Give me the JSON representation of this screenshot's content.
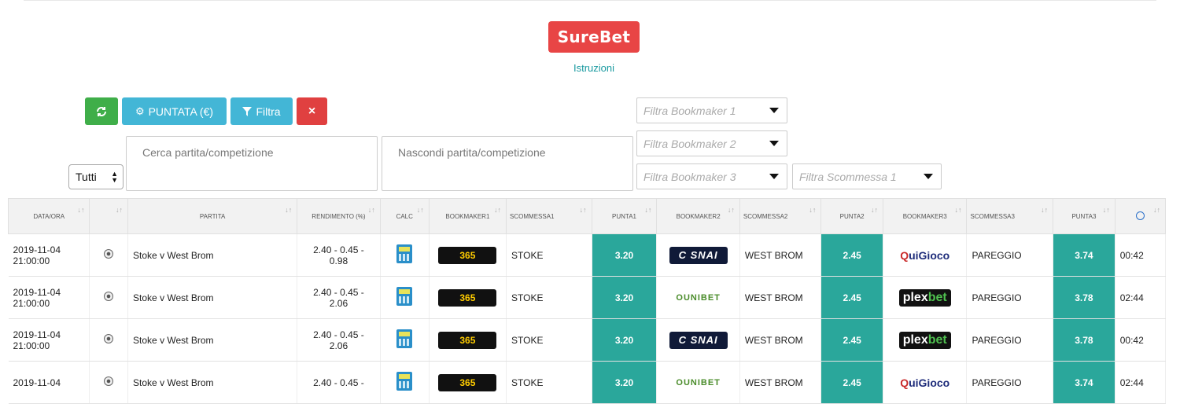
{
  "header": {
    "brand": "SureBet",
    "instructions": "Istruzioni"
  },
  "toolbar": {
    "refresh_icon": "refresh-icon",
    "stake_label": "PUNTATA (€)",
    "filter_label": "Filtra",
    "clear_label": "×"
  },
  "filters": {
    "bookmaker1": "Filtra Bookmaker 1",
    "bookmaker2": "Filtra Bookmaker 2",
    "bookmaker3": "Filtra Bookmaker 3",
    "bet1": "Filtra Scommessa 1",
    "search_placeholder": "Cerca partita/competizione",
    "hide_placeholder": "Nascondi partita/competizione",
    "scope_selected": "Tutti"
  },
  "table": {
    "headers": [
      "DATA/ORA",
      "",
      "PARTITA",
      "RENDIMENTO (%)",
      "CALC",
      "BOOKMAKER1",
      "SCOMMESSA1",
      "PUNTA1",
      "BOOKMAKER2",
      "SCOMMESSA2",
      "PUNTA2",
      "BOOKMAKER3",
      "SCOMMESSA3",
      "PUNTA3",
      ""
    ],
    "rows": [
      {
        "date": "2019-11-04",
        "time": "21:00:00",
        "match": "Stoke v West Brom",
        "yield1": "2.40 - 0.45 -",
        "yield2": "0.98",
        "bm1": "planetwin365",
        "bet1": "STOKE",
        "odd1": "3.20",
        "bm2": "snai",
        "bet2": "WEST BROM",
        "odd2": "2.45",
        "bm3": "quigioco",
        "bet3": "PAREGGIO",
        "odd3": "3.74",
        "timer": "00:42"
      },
      {
        "date": "2019-11-04",
        "time": "21:00:00",
        "match": "Stoke v West Brom",
        "yield1": "2.40 - 0.45 -",
        "yield2": "2.06",
        "bm1": "planetwin365",
        "bet1": "STOKE",
        "odd1": "3.20",
        "bm2": "unibet",
        "bet2": "WEST BROM",
        "odd2": "2.45",
        "bm3": "plexbet",
        "bet3": "PAREGGIO",
        "odd3": "3.78",
        "timer": "02:44"
      },
      {
        "date": "2019-11-04",
        "time": "21:00:00",
        "match": "Stoke v West Brom",
        "yield1": "2.40 - 0.45 -",
        "yield2": "2.06",
        "bm1": "planetwin365",
        "bet1": "STOKE",
        "odd1": "3.20",
        "bm2": "snai",
        "bet2": "WEST BROM",
        "odd2": "2.45",
        "bm3": "plexbet",
        "bet3": "PAREGGIO",
        "odd3": "3.78",
        "timer": "00:42"
      },
      {
        "date": "2019-11-04",
        "time": "",
        "match": "Stoke v West Brom",
        "yield1": "2.40 - 0.45 -",
        "yield2": "",
        "bm1": "planetwin365",
        "bet1": "STOKE",
        "odd1": "3.20",
        "bm2": "unibet",
        "bet2": "WEST BROM",
        "odd2": "2.45",
        "bm3": "quigioco",
        "bet3": "PAREGGIO",
        "odd3": "3.74",
        "timer": "02:44"
      }
    ]
  },
  "logos": {
    "planetwin365": "365",
    "snai": "C SNAI",
    "unibet": "OUNIBET",
    "plexbet_a": "plex",
    "plexbet_b": "bet",
    "quigioco_a": "Q",
    "quigioco_b": "uiGioco"
  },
  "colors": {
    "brand": "#e84545",
    "teal": "#2aa79b",
    "green": "#3fae49",
    "blue": "#43b6d6",
    "red": "#e04040"
  }
}
